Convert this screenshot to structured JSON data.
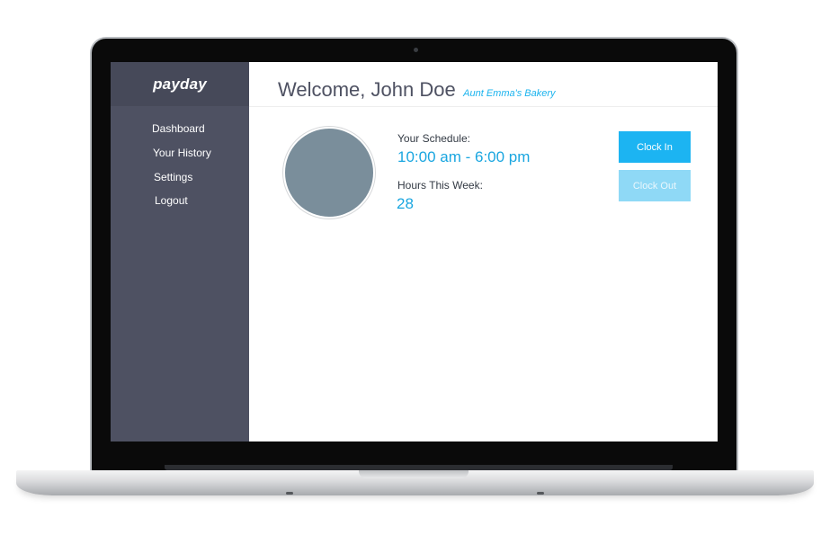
{
  "app": {
    "brand": "payday"
  },
  "sidebar": {
    "items": [
      {
        "label": "Dashboard"
      },
      {
        "label": "Your History"
      },
      {
        "label": "Settings"
      },
      {
        "label": "Logout"
      }
    ]
  },
  "header": {
    "welcome": "Welcome, John Doe",
    "company": "Aunt Emma's Bakery"
  },
  "schedule": {
    "label": "Your Schedule:",
    "value": "10:00 am - 6:00 pm"
  },
  "hours": {
    "label": "Hours This Week:",
    "value": "28"
  },
  "actions": {
    "clock_in_label": "Clock In",
    "clock_out_label": "Clock Out"
  },
  "colors": {
    "accent": "#1cb4f2",
    "accent_disabled": "#8fd9f6",
    "sidebar": "#4e5162",
    "avatar": "#7a8e9b"
  }
}
